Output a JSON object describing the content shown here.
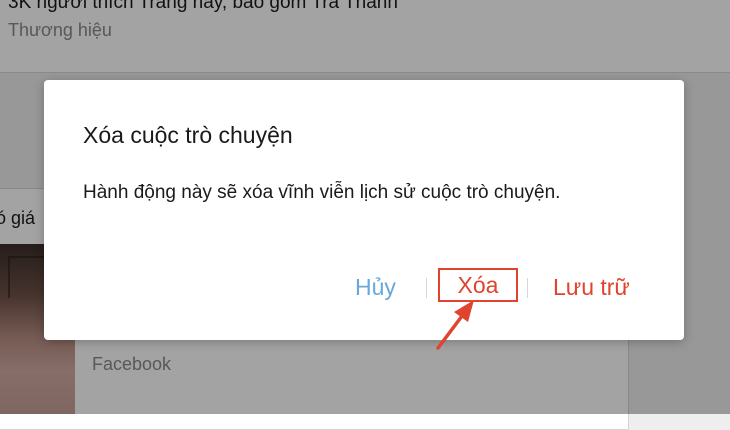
{
  "background": {
    "top_line": "3K người thích Trang này, bao gồm Trà Thanh",
    "top_subline": "Thương hiệu",
    "card_partial_text": "ó giá",
    "card_source": "Facebook"
  },
  "dialog": {
    "title": "Xóa cuộc trò chuyện",
    "message": "Hành động này sẽ xóa vĩnh viễn lịch sử cuộc trò chuyện.",
    "buttons": {
      "cancel": "Hủy",
      "delete": "Xóa",
      "archive": "Lưu trữ"
    }
  },
  "colors": {
    "cancel": "#6aa8dc",
    "destructive": "#e0432e",
    "highlight_box": "#e0432e",
    "arrow": "#e0432e"
  },
  "icons": {
    "annotation_arrow": "arrow-up-right"
  }
}
